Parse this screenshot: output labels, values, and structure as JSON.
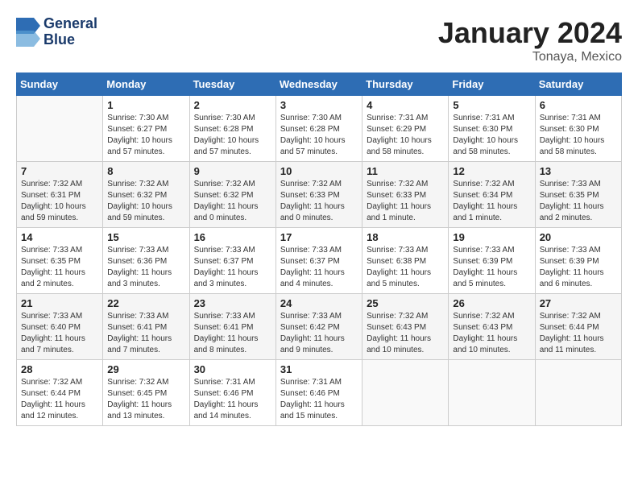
{
  "header": {
    "logo_line1": "General",
    "logo_line2": "Blue",
    "month": "January 2024",
    "location": "Tonaya, Mexico"
  },
  "days_of_week": [
    "Sunday",
    "Monday",
    "Tuesday",
    "Wednesday",
    "Thursday",
    "Friday",
    "Saturday"
  ],
  "weeks": [
    [
      {
        "num": "",
        "info": ""
      },
      {
        "num": "1",
        "info": "Sunrise: 7:30 AM\nSunset: 6:27 PM\nDaylight: 10 hours\nand 57 minutes."
      },
      {
        "num": "2",
        "info": "Sunrise: 7:30 AM\nSunset: 6:28 PM\nDaylight: 10 hours\nand 57 minutes."
      },
      {
        "num": "3",
        "info": "Sunrise: 7:30 AM\nSunset: 6:28 PM\nDaylight: 10 hours\nand 57 minutes."
      },
      {
        "num": "4",
        "info": "Sunrise: 7:31 AM\nSunset: 6:29 PM\nDaylight: 10 hours\nand 58 minutes."
      },
      {
        "num": "5",
        "info": "Sunrise: 7:31 AM\nSunset: 6:30 PM\nDaylight: 10 hours\nand 58 minutes."
      },
      {
        "num": "6",
        "info": "Sunrise: 7:31 AM\nSunset: 6:30 PM\nDaylight: 10 hours\nand 58 minutes."
      }
    ],
    [
      {
        "num": "7",
        "info": "Sunrise: 7:32 AM\nSunset: 6:31 PM\nDaylight: 10 hours\nand 59 minutes."
      },
      {
        "num": "8",
        "info": "Sunrise: 7:32 AM\nSunset: 6:32 PM\nDaylight: 10 hours\nand 59 minutes."
      },
      {
        "num": "9",
        "info": "Sunrise: 7:32 AM\nSunset: 6:32 PM\nDaylight: 11 hours\nand 0 minutes."
      },
      {
        "num": "10",
        "info": "Sunrise: 7:32 AM\nSunset: 6:33 PM\nDaylight: 11 hours\nand 0 minutes."
      },
      {
        "num": "11",
        "info": "Sunrise: 7:32 AM\nSunset: 6:33 PM\nDaylight: 11 hours\nand 1 minute."
      },
      {
        "num": "12",
        "info": "Sunrise: 7:32 AM\nSunset: 6:34 PM\nDaylight: 11 hours\nand 1 minute."
      },
      {
        "num": "13",
        "info": "Sunrise: 7:33 AM\nSunset: 6:35 PM\nDaylight: 11 hours\nand 2 minutes."
      }
    ],
    [
      {
        "num": "14",
        "info": "Sunrise: 7:33 AM\nSunset: 6:35 PM\nDaylight: 11 hours\nand 2 minutes."
      },
      {
        "num": "15",
        "info": "Sunrise: 7:33 AM\nSunset: 6:36 PM\nDaylight: 11 hours\nand 3 minutes."
      },
      {
        "num": "16",
        "info": "Sunrise: 7:33 AM\nSunset: 6:37 PM\nDaylight: 11 hours\nand 3 minutes."
      },
      {
        "num": "17",
        "info": "Sunrise: 7:33 AM\nSunset: 6:37 PM\nDaylight: 11 hours\nand 4 minutes."
      },
      {
        "num": "18",
        "info": "Sunrise: 7:33 AM\nSunset: 6:38 PM\nDaylight: 11 hours\nand 5 minutes."
      },
      {
        "num": "19",
        "info": "Sunrise: 7:33 AM\nSunset: 6:39 PM\nDaylight: 11 hours\nand 5 minutes."
      },
      {
        "num": "20",
        "info": "Sunrise: 7:33 AM\nSunset: 6:39 PM\nDaylight: 11 hours\nand 6 minutes."
      }
    ],
    [
      {
        "num": "21",
        "info": "Sunrise: 7:33 AM\nSunset: 6:40 PM\nDaylight: 11 hours\nand 7 minutes."
      },
      {
        "num": "22",
        "info": "Sunrise: 7:33 AM\nSunset: 6:41 PM\nDaylight: 11 hours\nand 7 minutes."
      },
      {
        "num": "23",
        "info": "Sunrise: 7:33 AM\nSunset: 6:41 PM\nDaylight: 11 hours\nand 8 minutes."
      },
      {
        "num": "24",
        "info": "Sunrise: 7:33 AM\nSunset: 6:42 PM\nDaylight: 11 hours\nand 9 minutes."
      },
      {
        "num": "25",
        "info": "Sunrise: 7:32 AM\nSunset: 6:43 PM\nDaylight: 11 hours\nand 10 minutes."
      },
      {
        "num": "26",
        "info": "Sunrise: 7:32 AM\nSunset: 6:43 PM\nDaylight: 11 hours\nand 10 minutes."
      },
      {
        "num": "27",
        "info": "Sunrise: 7:32 AM\nSunset: 6:44 PM\nDaylight: 11 hours\nand 11 minutes."
      }
    ],
    [
      {
        "num": "28",
        "info": "Sunrise: 7:32 AM\nSunset: 6:44 PM\nDaylight: 11 hours\nand 12 minutes."
      },
      {
        "num": "29",
        "info": "Sunrise: 7:32 AM\nSunset: 6:45 PM\nDaylight: 11 hours\nand 13 minutes."
      },
      {
        "num": "30",
        "info": "Sunrise: 7:31 AM\nSunset: 6:46 PM\nDaylight: 11 hours\nand 14 minutes."
      },
      {
        "num": "31",
        "info": "Sunrise: 7:31 AM\nSunset: 6:46 PM\nDaylight: 11 hours\nand 15 minutes."
      },
      {
        "num": "",
        "info": ""
      },
      {
        "num": "",
        "info": ""
      },
      {
        "num": "",
        "info": ""
      }
    ]
  ]
}
